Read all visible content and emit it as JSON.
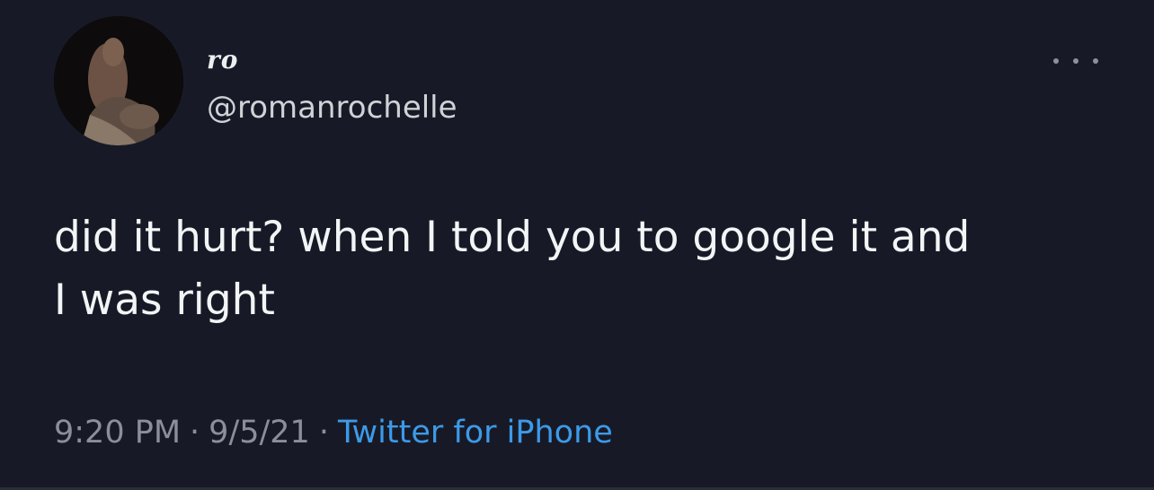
{
  "user": {
    "display_name": "ro",
    "handle": "@romanrochelle",
    "avatar_icon": "profile-photo"
  },
  "tweet": {
    "text_line1": "did it hurt? when I told you to google it and",
    "text_line2": "I was right"
  },
  "meta": {
    "time": "9:20 PM",
    "date": "9/5/21",
    "separator": "·",
    "source": "Twitter for iPhone"
  },
  "menu": {
    "icon": "more-options-icon"
  },
  "colors": {
    "background": "#171a26",
    "text": "#f3f4f6",
    "muted": "#8a8f99",
    "link": "#3d9ae8"
  }
}
